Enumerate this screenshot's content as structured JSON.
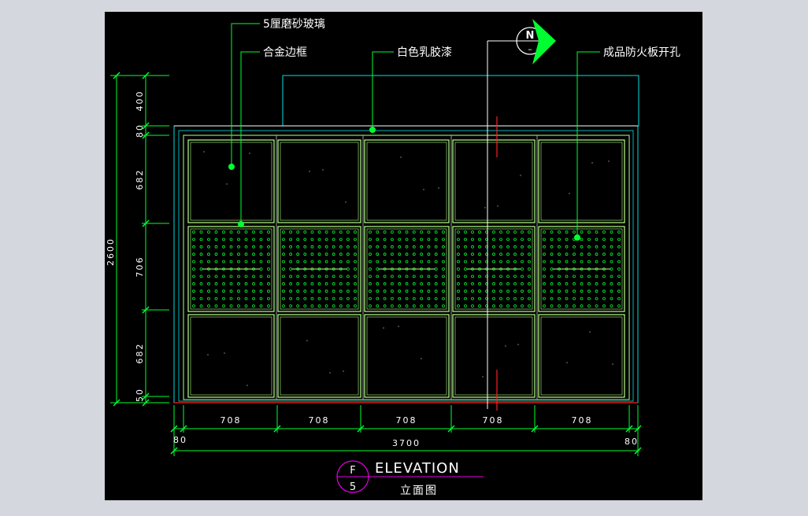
{
  "annotations": {
    "glass": "5厘磨砂玻璃",
    "alloy_frame": "合金边框",
    "paint": "白色乳胶漆",
    "fireproof_board": "成品防火板开孔"
  },
  "north_arrow": {
    "letter": "N",
    "sub": "–"
  },
  "dimensions": {
    "vertical": [
      "400",
      "80",
      "682",
      "706",
      "682",
      "50"
    ],
    "total_height": "2600",
    "horizontal": [
      "708",
      "708",
      "708",
      "708",
      "708"
    ],
    "left_margin": "80",
    "right_margin": "80",
    "total_width": "3700"
  },
  "title_block": {
    "letter": "F",
    "number": "5",
    "title_en": "ELEVATION",
    "title_cn": "立面图"
  },
  "colors": {
    "canvas": "#000000",
    "frame_line": "#b8ff8c",
    "dim_line": "#00ff30",
    "cyan": "#00e0e0",
    "leader": "#00ff30",
    "magenta": "#e000e0",
    "red": "#ff2020"
  }
}
